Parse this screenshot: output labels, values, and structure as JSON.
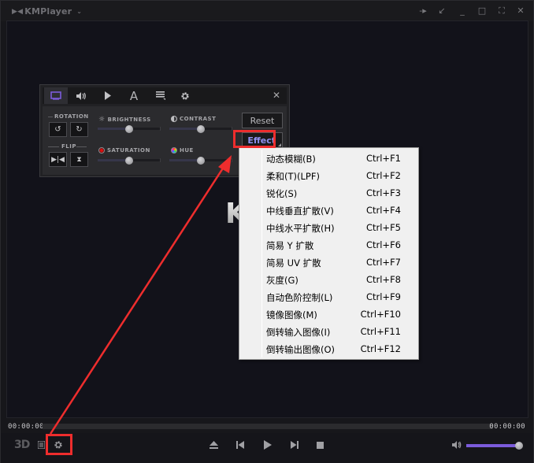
{
  "titlebar": {
    "app_name": "KMPlayer",
    "logo_icon": "kmplayer-logo-icon",
    "menu_chevron": "chevron-down-icon",
    "buttons": [
      {
        "name": "pin-button",
        "icon": "pin-icon",
        "glyph": "-▸"
      },
      {
        "name": "mini-mode-button",
        "icon": "arrow-down-left-icon",
        "glyph": "↙"
      },
      {
        "name": "minimize-button",
        "icon": "minimize-icon",
        "glyph": "_"
      },
      {
        "name": "maximize-button",
        "icon": "maximize-icon",
        "glyph": "□"
      },
      {
        "name": "fullscreen-button",
        "icon": "fullscreen-icon",
        "glyph": "⛶"
      },
      {
        "name": "close-button",
        "icon": "close-icon",
        "glyph": "✕"
      }
    ]
  },
  "video": {
    "watermark": "K"
  },
  "control_panel": {
    "tabs": [
      {
        "name": "tab-video",
        "icon": "monitor-icon",
        "active": true
      },
      {
        "name": "tab-audio",
        "icon": "speaker-icon",
        "active": false
      },
      {
        "name": "tab-playback",
        "icon": "play-icon",
        "active": false
      },
      {
        "name": "tab-subtitle",
        "icon": "text-icon",
        "glyph": "A",
        "active": false
      },
      {
        "name": "tab-playlist",
        "icon": "list-icon",
        "active": false
      },
      {
        "name": "tab-settings",
        "icon": "gear-icon",
        "active": false
      }
    ],
    "close_glyph": "✕",
    "rotation_label": "ROTATION",
    "flip_label": "FLIP",
    "adjustments": [
      {
        "key": "brightness",
        "label": "BRIGHTNESS",
        "icon": "sun-icon",
        "value": 0.5
      },
      {
        "key": "contrast",
        "label": "CONTRAST",
        "icon": "contrast-icon",
        "value": 0.5
      },
      {
        "key": "saturation",
        "label": "SATURATION",
        "icon": "saturation-icon",
        "value": 0.5
      },
      {
        "key": "hue",
        "label": "HUE",
        "icon": "hue-icon",
        "value": 0.5
      }
    ],
    "reset_label": "Reset",
    "effect_label": "Effect"
  },
  "effect_menu": {
    "items": [
      {
        "label": "动态模糊(B)",
        "shortcut": "Ctrl+F1"
      },
      {
        "label": "柔和(T)(LPF)",
        "shortcut": "Ctrl+F2"
      },
      {
        "label": "锐化(S)",
        "shortcut": "Ctrl+F3"
      },
      {
        "label": "中线垂直扩散(V)",
        "shortcut": "Ctrl+F4"
      },
      {
        "label": "中线水平扩散(H)",
        "shortcut": "Ctrl+F5"
      },
      {
        "label": "简易 Y 扩散",
        "shortcut": "Ctrl+F6"
      },
      {
        "label": "简易 UV 扩散",
        "shortcut": "Ctrl+F7"
      },
      {
        "label": "灰度(G)",
        "shortcut": "Ctrl+F8"
      },
      {
        "label": "自动色阶控制(L)",
        "shortcut": "Ctrl+F9"
      },
      {
        "label": "镜像图像(M)",
        "shortcut": "Ctrl+F10"
      },
      {
        "label": "倒转输入图像(I)",
        "shortcut": "Ctrl+F11"
      },
      {
        "label": "倒转输出图像(O)",
        "shortcut": "Ctrl+F12"
      }
    ]
  },
  "playback": {
    "time_elapsed": "00:00:00",
    "time_total": "00:00:00",
    "seek_progress": 0,
    "btn_3d_label": "3D",
    "volume_level": 1.0,
    "accent_color": "#7b5bdb"
  },
  "annotations": {
    "color": "#ee2d2d"
  }
}
